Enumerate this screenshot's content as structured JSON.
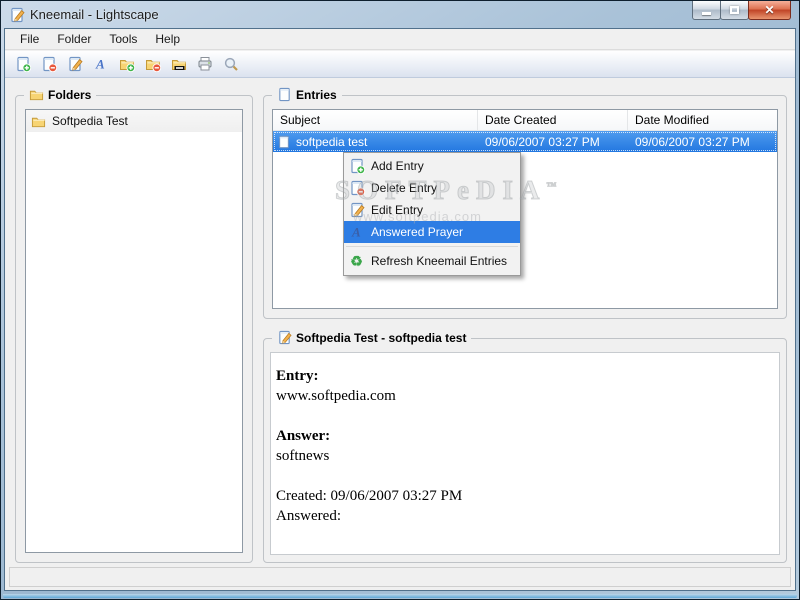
{
  "window": {
    "title": "Kneemail - Lightscape",
    "close_glyph": "✕"
  },
  "menubar": {
    "items": [
      {
        "label": "File"
      },
      {
        "label": "Folder"
      },
      {
        "label": "Tools"
      },
      {
        "label": "Help"
      }
    ]
  },
  "toolbar": {
    "icons": [
      "add-entry",
      "delete-entry",
      "edit-entry",
      "answered-prayer",
      "add-folder",
      "delete-folder",
      "rename-folder",
      "print",
      "search"
    ]
  },
  "folders_panel": {
    "title": "Folders",
    "items": [
      {
        "label": "Softpedia Test"
      }
    ]
  },
  "entries_panel": {
    "title": "Entries",
    "columns": [
      "Subject",
      "Date Created",
      "Date Modified"
    ],
    "rows": [
      {
        "subject": "softpedia test",
        "date_created": "09/06/2007 03:27 PM",
        "date_modified": "09/06/2007 03:27 PM",
        "selected": true
      }
    ]
  },
  "context_menu": {
    "items": [
      {
        "label": "Add Entry",
        "icon": "doc-plus"
      },
      {
        "label": "Delete Entry",
        "icon": "doc-minus"
      },
      {
        "label": "Edit Entry",
        "icon": "doc-pencil"
      },
      {
        "label": "Answered Prayer",
        "icon": "letter-a",
        "highlighted": true
      },
      {
        "label": "Refresh Kneemail Entries",
        "icon": "refresh",
        "refresh_glyph": "♻"
      }
    ]
  },
  "detail_panel": {
    "title": "Softpedia Test - softpedia test",
    "entry_label": "Entry:",
    "entry_value": "www.softpedia.com",
    "answer_label": "Answer:",
    "answer_value": "softnews",
    "created_line": "Created: 09/06/2007 03:27 PM",
    "answered_line": "Answered:"
  },
  "watermark": {
    "line1": "SOFTPeDIA",
    "tm": "™",
    "line2": "www.softpedia.com"
  },
  "colors": {
    "selection_blue": "#2e7de4",
    "row_selection_top": "#4f9bee",
    "row_selection_bottom": "#2277e0",
    "close_button_red": "#c04326",
    "titlebar_top": "#cddbea",
    "titlebar_bottom": "#9bb7d0",
    "refresh_green": "#3aa64a"
  }
}
